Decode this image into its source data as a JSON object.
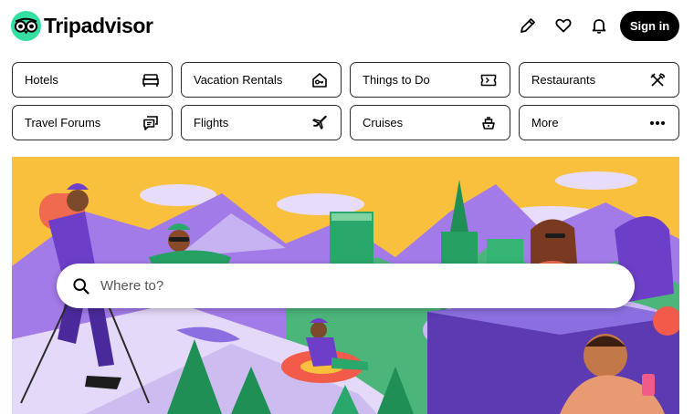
{
  "brand": {
    "name": "Tripadvisor",
    "logo_color": "#34e0a1"
  },
  "header": {
    "icons": [
      "pencil-icon",
      "heart-icon",
      "bell-icon"
    ],
    "signin_label": "Sign in"
  },
  "categories": [
    {
      "label": "Hotels",
      "icon": "bed-icon"
    },
    {
      "label": "Vacation Rentals",
      "icon": "house-key-icon"
    },
    {
      "label": "Things to Do",
      "icon": "ticket-icon"
    },
    {
      "label": "Restaurants",
      "icon": "utensils-icon"
    },
    {
      "label": "Travel Forums",
      "icon": "chat-icon"
    },
    {
      "label": "Flights",
      "icon": "plane-icon"
    },
    {
      "label": "Cruises",
      "icon": "ship-icon"
    },
    {
      "label": "More",
      "icon": "more-dots-icon"
    }
  ],
  "search": {
    "placeholder": "Where to?",
    "value": ""
  },
  "hero": {
    "sky_color": "#f9c03d",
    "snow_color": "#8b6fe0",
    "tree_color": "#1f8f55"
  }
}
